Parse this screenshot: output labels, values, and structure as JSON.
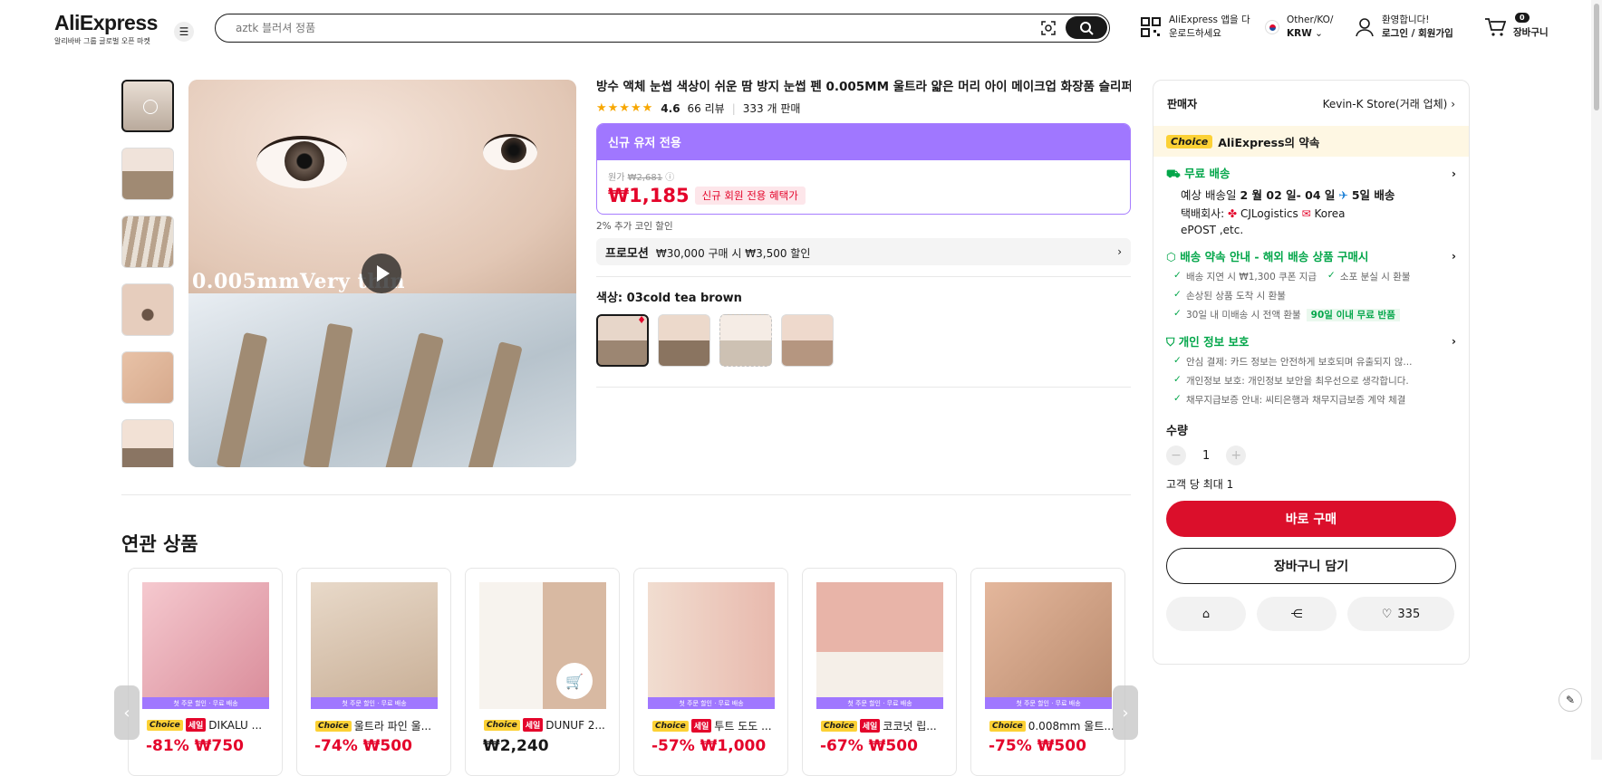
{
  "header": {
    "brand": "AliExpress",
    "tagline": "알리바바 그룹 글로벌 오픈 마켓",
    "search_placeholder": "aztk 블러셔 정품",
    "app_line1": "AliExpress 앱을 다",
    "app_line2": "운로드하세요",
    "lang_line1": "Other/KO/",
    "lang_line2": "KRW",
    "acct_line1": "환영합니다!",
    "acct_line2": "로그인 / 회원가입",
    "cart_count": "0",
    "cart_label": "장바구니"
  },
  "product": {
    "title": "방수 액체 눈썹 색상이 쉬운 땀 방지 눈썹 펜 0.005MM 울트라 얇은 머리 아이 메이크업 화장품 슬리퍼 펜",
    "rating": "4.6",
    "reviews": "66 리뷰",
    "sold": "333 개 판매",
    "image_text": "0.005mmVery thin",
    "newuser_header": "신규 유저 전용",
    "orig_label": "원가",
    "orig_price": "₩2,681",
    "price": "₩1,185",
    "price_chip": "신규 회원 전용 혜택가",
    "coin": "2% 추가 코인 할인",
    "promo_label": "프로모션",
    "promo_text": "₩30,000 구매 시 ₩3,500 할인",
    "color_label": "색상: 03cold tea brown"
  },
  "sidebar": {
    "seller_label": "판매자",
    "seller_name": "Kevin-K Store(거래 업체)",
    "choice": "Choice",
    "promise": "AliExpress의 약속",
    "shipping_title": "무료 배송",
    "shipping_date_pre": "예상 배송일",
    "shipping_date": "2 월 02 일- 04 일",
    "shipping_days": "5일 배송",
    "courier_label": "택배회사:",
    "courier_1": "CJLogistics",
    "courier_2": "Korea",
    "courier_3": "ePOST ,etc.",
    "guarantee_title": "배송 약속 안내 - 해외 배송 상품 구매시",
    "g1": "배송 지연 시 ₩1,300 쿠폰 지급",
    "g2": "소포 분실 시 환불",
    "g3": "손상된 상품 도착 시 환불",
    "g4": "30일 내 미배송 시 전액 환불",
    "g4_badge": "90일 이내 무료 반품",
    "privacy_title": "개인 정보 보호",
    "p1": "안심 결제: 카드 정보는 안전하게 보호되며 유출되지 않...",
    "p2": "개인정보 보호: 개인정보 보안을 최우선으로 생각합니다.",
    "p3": "채무지급보증 안내: 씨티은행과 채무지급보증 계약 체결",
    "qty_label": "수량",
    "qty_value": "1",
    "limit": "고객 당 최대 1",
    "buy_now": "바로 구매",
    "add_cart": "장바구니 담기",
    "wish_count": "335"
  },
  "related": {
    "title": "연관 상품",
    "ribbon": "첫 주문 할인 · 무료 배송",
    "items": [
      {
        "choice": "Choice",
        "sale": "세일",
        "name": "DIKALU ...",
        "discount": "-81%",
        "price": "₩750"
      },
      {
        "choice": "Choice",
        "sale": "",
        "name": "울트라 파인 울...",
        "discount": "-74%",
        "price": "₩500"
      },
      {
        "choice": "Choice",
        "sale": "세일",
        "name": "DUNUF 2...",
        "discount": "",
        "price": "₩2,240"
      },
      {
        "choice": "Choice",
        "sale": "세일",
        "name": "투트 도도 ...",
        "discount": "-57%",
        "price": "₩1,000"
      },
      {
        "choice": "Choice",
        "sale": "세일",
        "name": "코코넛 립...",
        "discount": "-67%",
        "price": "₩500"
      },
      {
        "choice": "Choice",
        "sale": "",
        "name": "0.008mm 울트...",
        "discount": "-75%",
        "price": "₩500"
      }
    ]
  }
}
